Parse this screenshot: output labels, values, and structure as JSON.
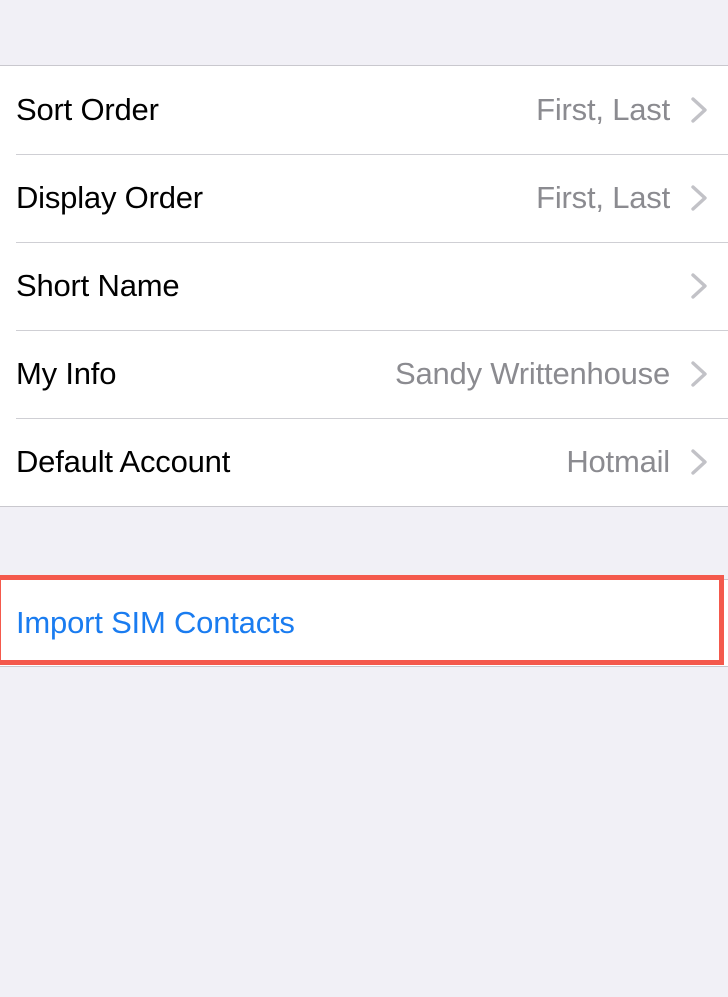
{
  "screen": {
    "name": "contacts-settings",
    "background_color": "#f1f0f6",
    "surface_color": "#ffffff"
  },
  "colors": {
    "label": "#000000",
    "value": "#8b8b90",
    "accent_link": "#1a7cf0",
    "separator": "#cfcfd4",
    "highlight": "#f4594c"
  },
  "settings_section": {
    "rows": [
      {
        "label": "Sort Order",
        "value": "First, Last",
        "accessory": "chevron-right-icon"
      },
      {
        "label": "Display Order",
        "value": "First, Last",
        "accessory": "chevron-right-icon"
      },
      {
        "label": "Short Name",
        "value": "",
        "accessory": "chevron-right-icon"
      },
      {
        "label": "My Info",
        "value": "Sandy Writtenhouse",
        "accessory": "chevron-right-icon"
      },
      {
        "label": "Default Account",
        "value": "Hotmail",
        "accessory": "chevron-right-icon"
      }
    ]
  },
  "action_section": {
    "import_sim_contacts": "Import SIM Contacts"
  }
}
